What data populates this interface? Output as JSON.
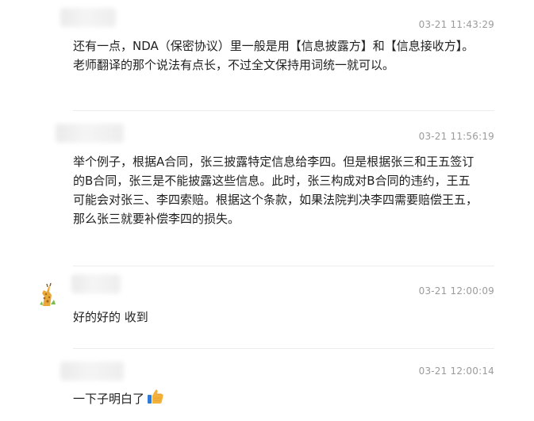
{
  "messages": [
    {
      "time": "03-21 11:43:29",
      "text": "还有一点，NDA（保密协议）里一般是用【信息披露方】和【信息接收方】。老师翻译的那个说法有点长，不过全文保持用词统一就可以。"
    },
    {
      "time": "03-21 11:56:19",
      "text": "举个例子，根据A合同，张三披露特定信息给李四。但是根据张三和王五签订的B合同，张三是不能披露这些信息。此时，张三构成对B合同的违约，王五可能会对张三、李四索赔。根据这个条款，如果法院判决李四需要赔偿王五，那么张三就要补偿李四的损失。"
    },
    {
      "time": "03-21 12:00:09",
      "text": "好的好的 收到",
      "avatar_icon": "giraffe-avatar-icon"
    },
    {
      "time": "03-21 12:00:14",
      "text": "一下子明白了",
      "emoji_icon": "thumbs-up-icon"
    }
  ],
  "colors": {
    "timestamp": "#9b9b9b",
    "text": "#1f1f1f",
    "divider": "#ececec",
    "thumb": "#f3b23a"
  }
}
